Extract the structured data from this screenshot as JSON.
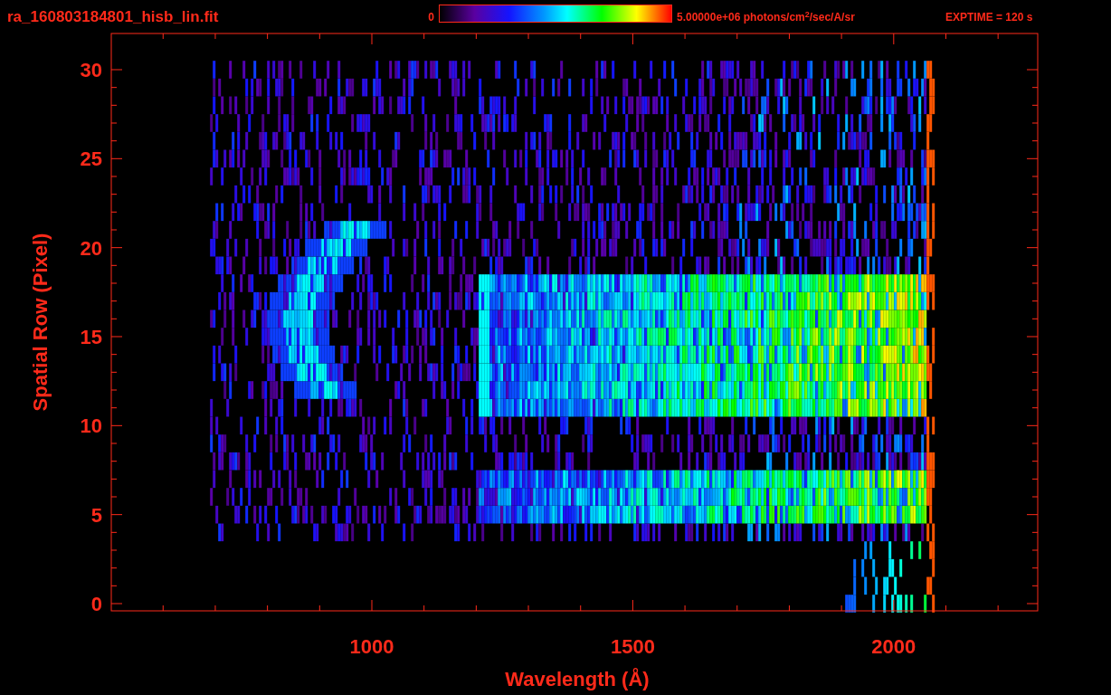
{
  "title": "ra_160803184801_hisb_lin.fit",
  "colorbar": {
    "min_label": "0",
    "max_label": "5.00000e+06 photons/cm$^{2}$/sec/A/sr"
  },
  "exposure": "EXPTIME = 120 s",
  "plot": {
    "x_label": "Wavelength (Å)",
    "y_label": "Spatial Row (Pixel)",
    "x_ticks": [
      "1000",
      "1500",
      "2000"
    ],
    "y_ticks": [
      "30",
      "25",
      "20",
      "15",
      "10",
      "5",
      "0"
    ]
  }
}
